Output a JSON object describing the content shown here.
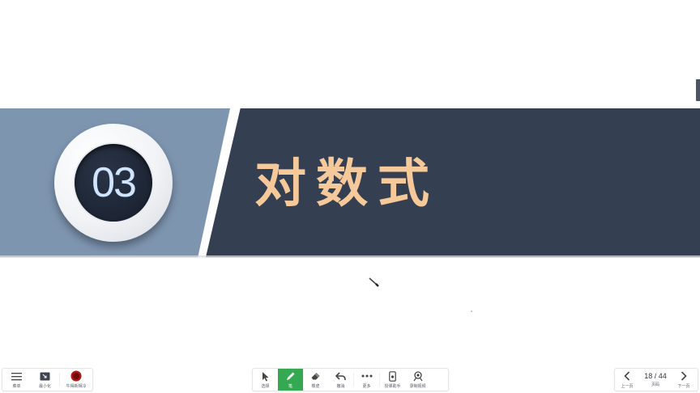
{
  "slide": {
    "number": "03",
    "title": "对数式",
    "colors": {
      "left_band": "#7e95b0",
      "right_band": "#353f52",
      "title": "#f5c99a",
      "number": "#cfe4ff"
    }
  },
  "toolbar_left": {
    "items": [
      {
        "label": "菜单",
        "icon": "menu-icon"
      },
      {
        "label": "最小化",
        "icon": "minimize-icon"
      },
      {
        "label": "牛得新相冷",
        "icon": "app-logo-icon"
      }
    ]
  },
  "toolbar_center": {
    "items": [
      {
        "label": "选择",
        "icon": "cursor-arrow-icon"
      },
      {
        "label": "笔",
        "icon": "pen-icon",
        "active": true
      },
      {
        "label": "橡皮",
        "icon": "eraser-icon"
      },
      {
        "label": "撤消",
        "icon": "undo-icon"
      },
      {
        "label": "更多",
        "icon": "more-icon"
      },
      {
        "label": "授课助手",
        "icon": "phone-icon"
      },
      {
        "label": "录制视频",
        "icon": "record-icon"
      }
    ],
    "active_color": "#35a852"
  },
  "toolbar_right": {
    "prev_label": "上一页",
    "page_text": "18 / 44",
    "page_label": "页码",
    "next_label": "下一页",
    "current_page": 18,
    "total_pages": 44
  }
}
